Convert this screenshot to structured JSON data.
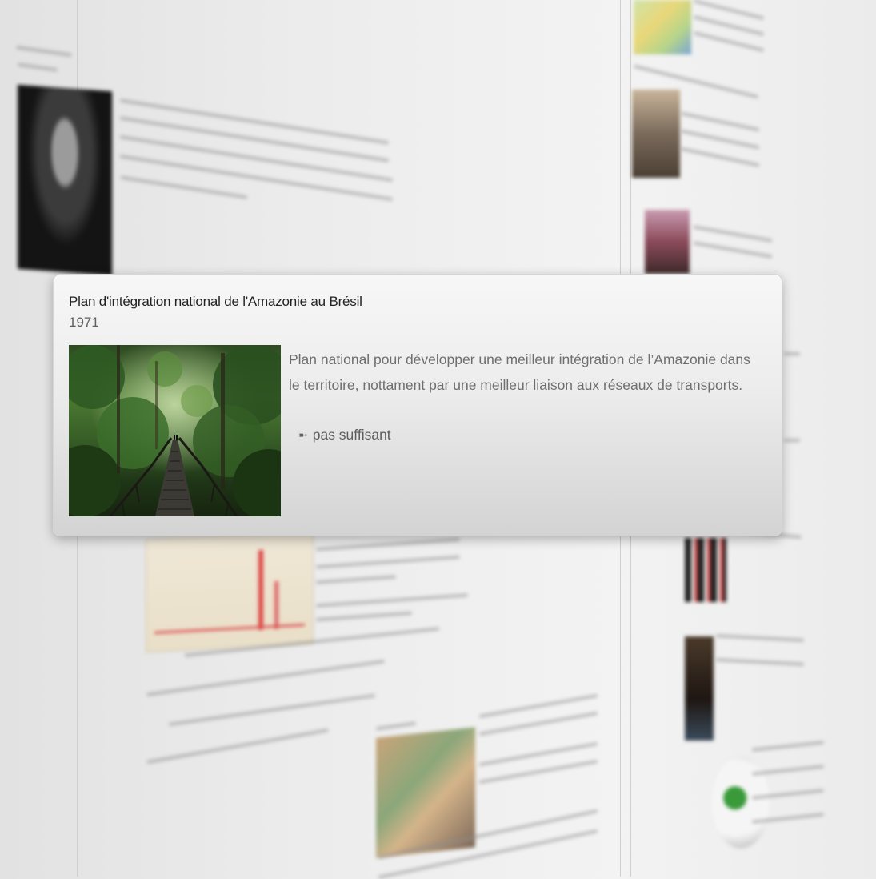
{
  "card": {
    "title": "Plan d'intégration national de l'Amazonie au Brésil",
    "year": "1971",
    "description": "Plan national pour développer une meilleur intégration de l’Amazonie dans le territoire, nottament par une meilleur liaison aux réseaux de transports.",
    "verdict_icon": "double-arrow-right-icon",
    "verdict": "pas suffisant"
  },
  "colors": {
    "card_top": "#f7f7f7",
    "card_bottom": "#d3d3d3",
    "title_text": "#222222",
    "body_text": "#6f6f6f"
  }
}
